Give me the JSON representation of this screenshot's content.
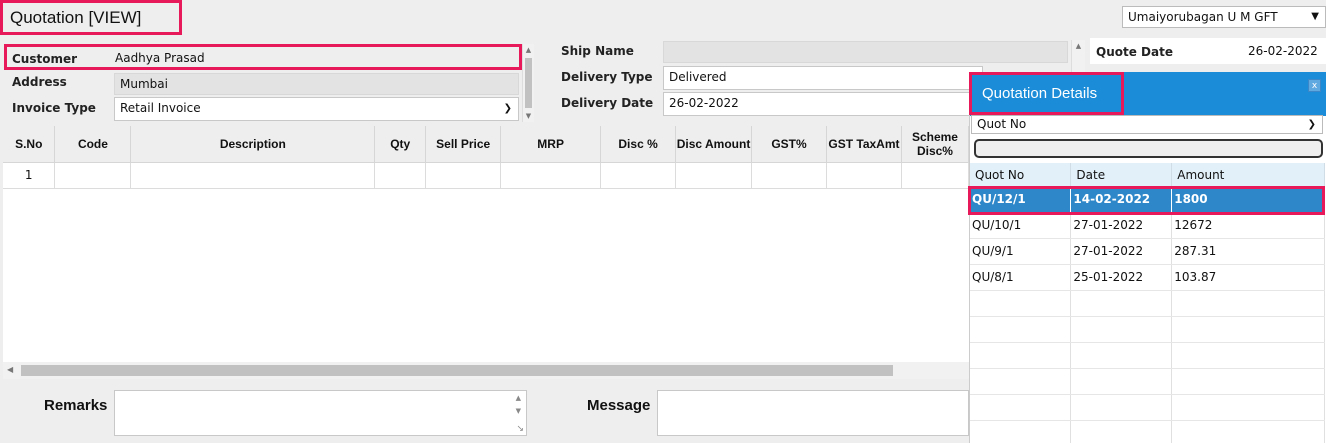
{
  "title": "Quotation [VIEW]",
  "company": "Umaiyorubagan U M GFT",
  "left_form": {
    "customer_label": "Customer",
    "customer_value": "Aadhya Prasad",
    "address_label": "Address",
    "address_value": "Mumbai",
    "invoice_type_label": "Invoice Type",
    "invoice_type_value": "Retail Invoice"
  },
  "mid_form": {
    "ship_name_label": "Ship Name",
    "ship_name_value": "",
    "delivery_type_label": "Delivery Type",
    "delivery_type_value": "Delivered",
    "delivery_date_label": "Delivery Date",
    "delivery_date_value": "26-02-2022"
  },
  "right_form": {
    "quote_date_label": "Quote Date",
    "quote_date_value": "26-02-2022"
  },
  "grid": {
    "columns": [
      "S.No",
      "Code",
      "Description",
      "Qty",
      "Sell Price",
      "MRP",
      "Disc %",
      "Disc Amount",
      "GST%",
      "GST TaxAmt",
      "Scheme Disc%"
    ],
    "rows": [
      [
        "1",
        "",
        "",
        "",
        "",
        "",
        "",
        "",
        "",
        "",
        ""
      ]
    ]
  },
  "bottom": {
    "remarks_label": "Remarks",
    "message_label": "Message"
  },
  "quotation_panel": {
    "title": "Quotation Details",
    "close_label": "x",
    "filter_select": "Quot No",
    "search_value": "",
    "columns": [
      "Quot No",
      "Date",
      "Amount"
    ],
    "rows": [
      [
        "QU/12/1",
        "14-02-2022",
        "1800"
      ],
      [
        "QU/10/1",
        "27-01-2022",
        "12672"
      ],
      [
        "QU/9/1",
        "27-01-2022",
        "287.31"
      ],
      [
        "QU/8/1",
        "25-01-2022",
        "103.87"
      ]
    ],
    "selected_row": 0,
    "empty_rows": 6
  },
  "colors": {
    "highlight": "#e8195b",
    "panel_header": "#1a8cd8",
    "selected_row": "#2e87c9"
  }
}
